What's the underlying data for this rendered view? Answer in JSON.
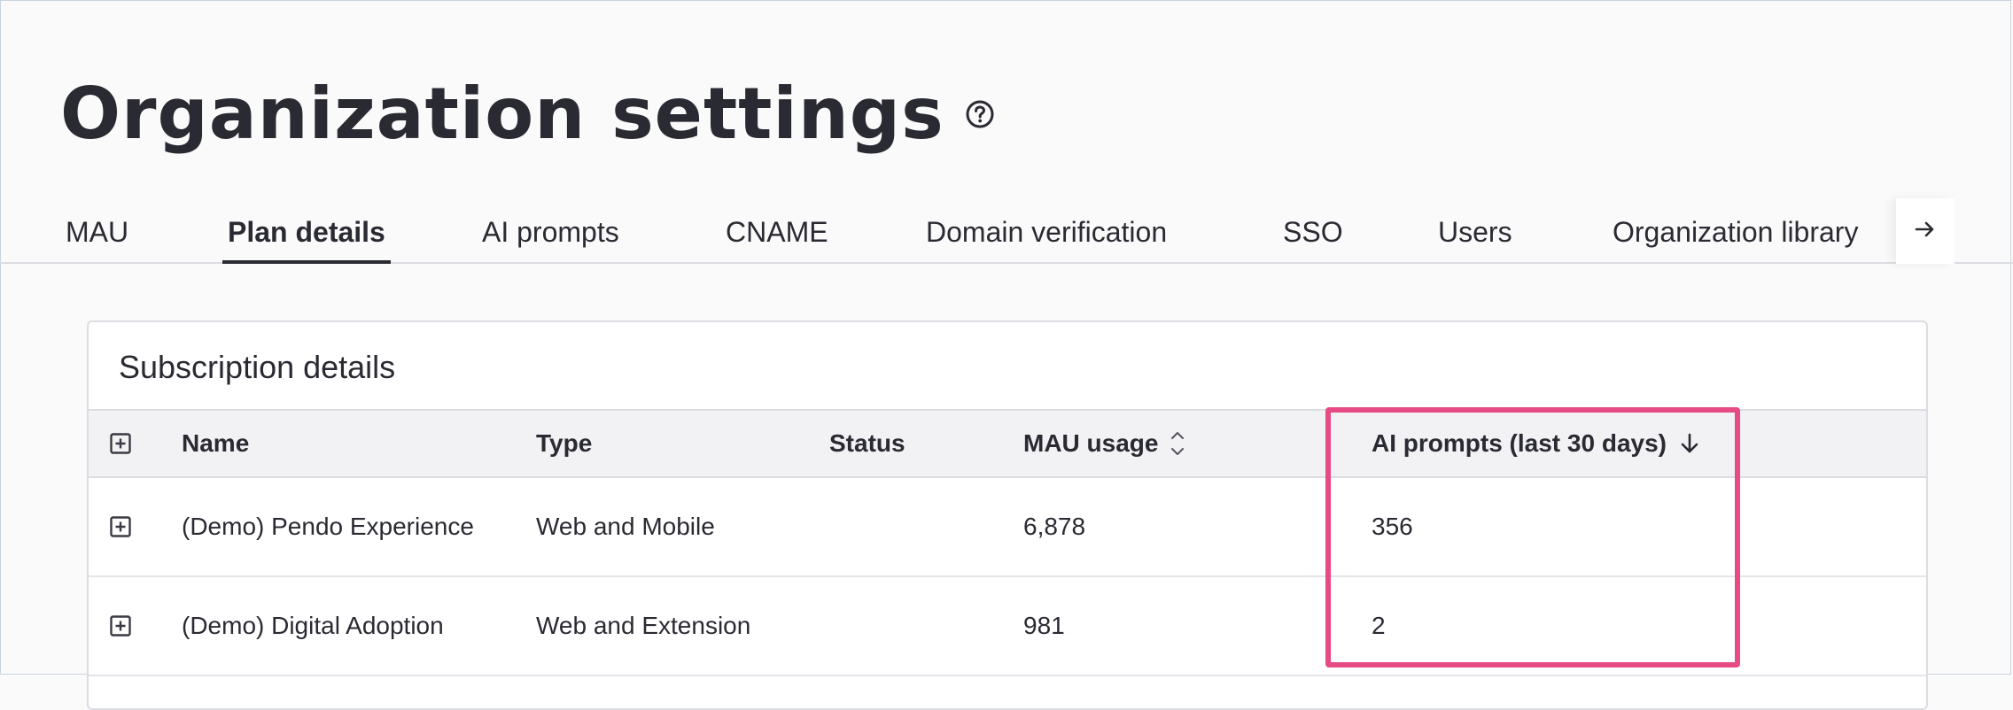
{
  "header": {
    "title": "Organization settings",
    "help_icon": "question-circle-icon"
  },
  "tabs": [
    {
      "label": "MAU",
      "active": false
    },
    {
      "label": "Plan details",
      "active": true
    },
    {
      "label": "AI prompts",
      "active": false
    },
    {
      "label": "CNAME",
      "active": false
    },
    {
      "label": "Domain verification",
      "active": false
    },
    {
      "label": "SSO",
      "active": false
    },
    {
      "label": "Users",
      "active": false
    },
    {
      "label": "Organization library",
      "active": false
    }
  ],
  "tab_scroll_icon": "arrow-right-icon",
  "subscription": {
    "title": "Subscription details",
    "columns": {
      "name": "Name",
      "type": "Type",
      "status": "Status",
      "mau_usage": "MAU usage",
      "ai_prompts": "AI prompts (last 30 days)"
    },
    "rows": [
      {
        "name": "(Demo) Pendo Experience",
        "type": "Web and Mobile",
        "status": "",
        "mau_usage": "6,878",
        "ai_prompts": "356"
      },
      {
        "name": "(Demo) Digital Adoption",
        "type": "Web and Extension",
        "status": "",
        "mau_usage": "981",
        "ai_prompts": "2"
      }
    ]
  },
  "colors": {
    "highlight": "#e64b86",
    "text": "#2a2a33",
    "header_bg": "#f2f2f4"
  }
}
